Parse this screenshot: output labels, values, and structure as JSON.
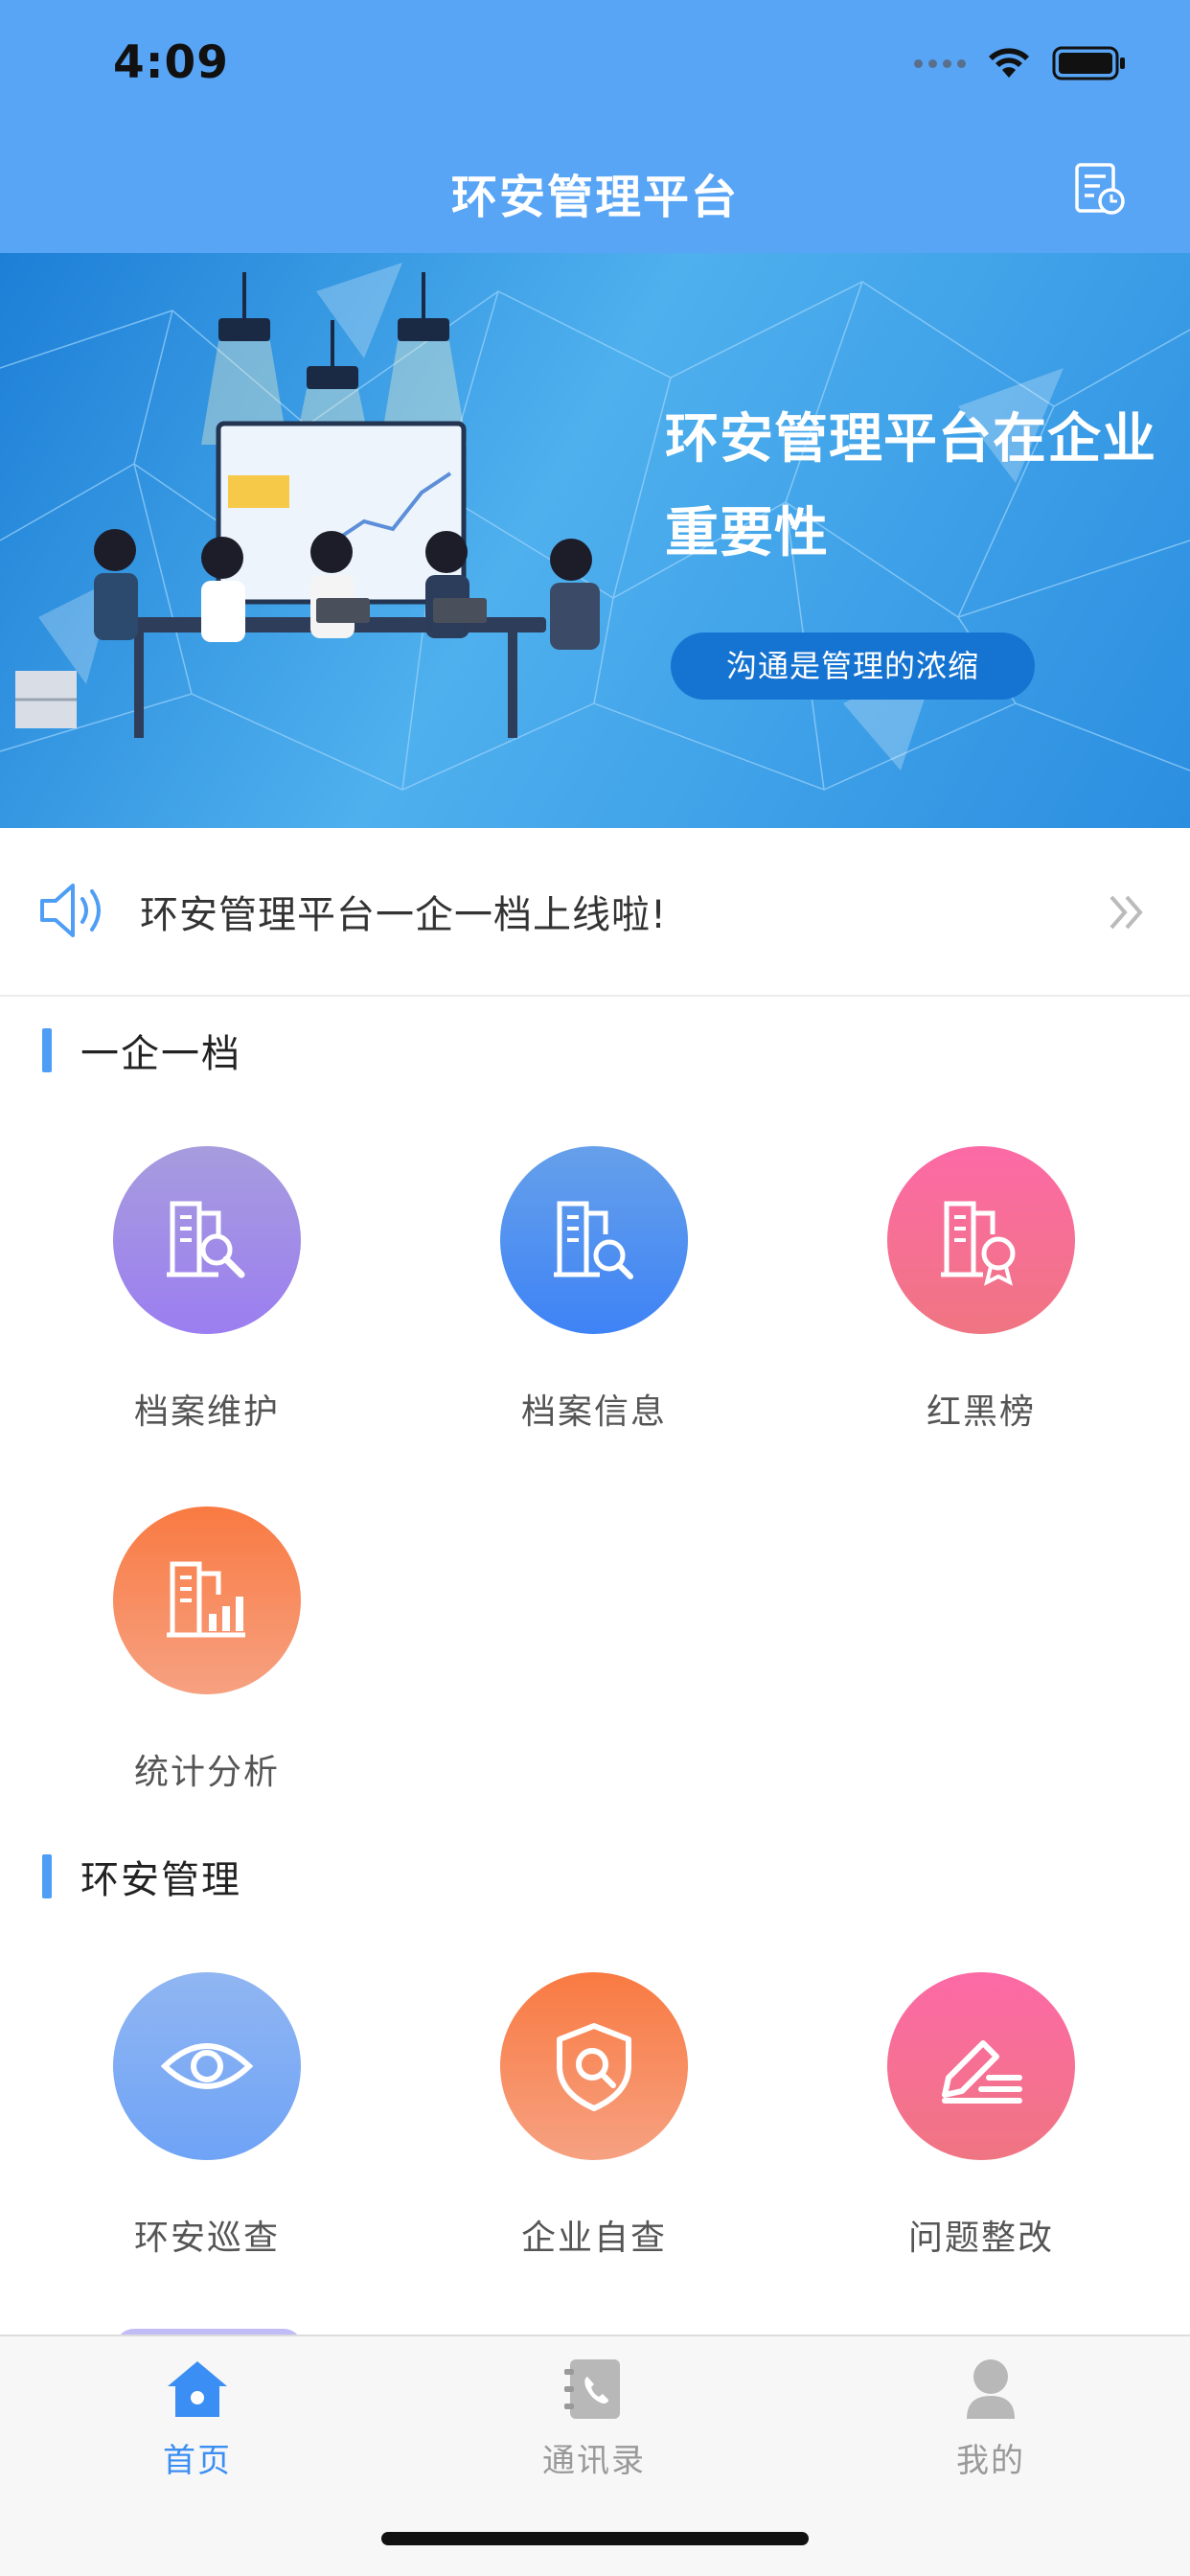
{
  "status_bar": {
    "time": "4:09"
  },
  "header": {
    "title": "环安管理平台",
    "history_icon": "document-clock-icon"
  },
  "banner": {
    "headline_line1": "环安管理平台在企业",
    "headline_line2": "重要性",
    "pill_text": "沟通是管理的浓缩"
  },
  "notice": {
    "text": "环安管理平台一企一档上线啦!",
    "icon": "speaker-icon",
    "arrow": "double-chevron-right-icon"
  },
  "sections": [
    {
      "title": "一企一档",
      "items": [
        {
          "label": "档案维护",
          "icon": "archive-search-icon",
          "color": "#9b7ef0"
        },
        {
          "label": "档案信息",
          "icon": "archive-magnify-icon",
          "color": "#3e83f6"
        },
        {
          "label": "红黑榜",
          "icon": "archive-badge-icon",
          "color": "#f07582"
        },
        {
          "label": "统计分析",
          "icon": "archive-chart-icon",
          "color": "#f97a42"
        }
      ]
    },
    {
      "title": "环安管理",
      "items": [
        {
          "label": "环安巡查",
          "icon": "eye-icon",
          "color": "#6fa3f6"
        },
        {
          "label": "企业自查",
          "icon": "shield-search-icon",
          "color": "#f97a42"
        },
        {
          "label": "问题整改",
          "icon": "pen-list-icon",
          "color": "#f07582"
        }
      ]
    }
  ],
  "tabbar": {
    "items": [
      {
        "label": "首页",
        "icon": "home-icon",
        "active": true
      },
      {
        "label": "通讯录",
        "icon": "contacts-book-icon",
        "active": false
      },
      {
        "label": "我的",
        "icon": "user-icon",
        "active": false
      }
    ],
    "active_color": "#3b8ef3"
  },
  "colors": {
    "header": "#58a4f5",
    "accent": "#4f9ef5"
  }
}
